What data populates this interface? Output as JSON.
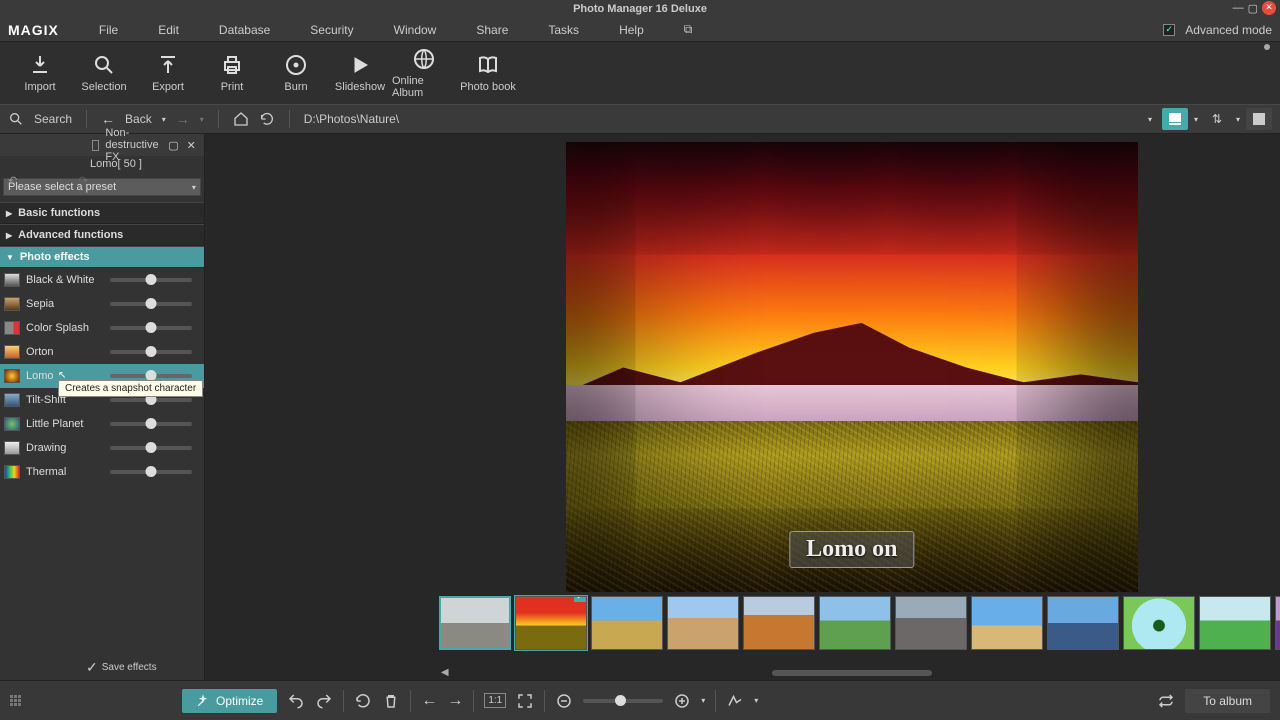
{
  "window": {
    "title": "Photo Manager 16 Deluxe"
  },
  "brand": "MAGIX",
  "menu": [
    "File",
    "Edit",
    "Database",
    "Security",
    "Window",
    "Share",
    "Tasks",
    "Help"
  ],
  "advanced_mode": {
    "label": "Advanced mode",
    "checked": true
  },
  "toolbar": [
    {
      "id": "import",
      "label": "Import"
    },
    {
      "id": "selection",
      "label": "Selection"
    },
    {
      "id": "export",
      "label": "Export"
    },
    {
      "id": "print",
      "label": "Print"
    },
    {
      "id": "burn",
      "label": "Burn"
    },
    {
      "id": "slideshow",
      "label": "Slideshow"
    },
    {
      "id": "online-album",
      "label": "Online Album"
    },
    {
      "id": "photo-book",
      "label": "Photo book"
    }
  ],
  "nav": {
    "search": "Search",
    "back": "Back",
    "path": "D:\\Photos\\Nature\\"
  },
  "fxpanel": {
    "nondestructive_label": "Non-destructive FX",
    "status": "Lomo[ 50 ]",
    "preset_placeholder": "Please select a preset",
    "groups": [
      {
        "label": "Basic functions",
        "expanded": false
      },
      {
        "label": "Advanced functions",
        "expanded": false
      },
      {
        "label": "Photo effects",
        "expanded": true
      }
    ],
    "effects": [
      {
        "label": "Black & White",
        "value": 50
      },
      {
        "label": "Sepia",
        "value": 50
      },
      {
        "label": "Color Splash",
        "value": 50
      },
      {
        "label": "Orton",
        "value": 50
      },
      {
        "label": "Lomo",
        "value": 50,
        "selected": true,
        "tooltip": "Creates a snapshot character"
      },
      {
        "label": "Tilt-Shift",
        "value": 50
      },
      {
        "label": "Little Planet",
        "value": 50
      },
      {
        "label": "Drawing",
        "value": 50
      },
      {
        "label": "Thermal",
        "value": 50
      }
    ],
    "save_effects": "Save\neffects"
  },
  "preview": {
    "overlay": "Lomo on"
  },
  "bottom": {
    "optimize": "Optimize",
    "to_album": "To album",
    "one_to_one": "1:1"
  }
}
